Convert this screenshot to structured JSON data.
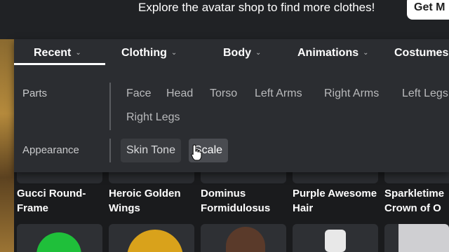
{
  "banner": {
    "text": "Explore the avatar shop to find more clothes!",
    "button_label": "Get M"
  },
  "tabs": [
    {
      "label": "Recent",
      "active": true
    },
    {
      "label": "Clothing"
    },
    {
      "label": "Body"
    },
    {
      "label": "Animations"
    },
    {
      "label": "Costumes"
    }
  ],
  "menu": {
    "parts_label": "Parts",
    "parts_options": [
      "Face",
      "Head",
      "Torso",
      "Left Arms",
      "Right Arms",
      "Left Legs",
      "Right Legs"
    ],
    "appearance_label": "Appearance",
    "appearance_options": [
      "Skin Tone",
      "Scale"
    ]
  },
  "items": [
    {
      "name": "Gucci Round-Frame"
    },
    {
      "name": "Heroic Golden Wings"
    },
    {
      "name": "Dominus Formidulosus"
    },
    {
      "name": "Purple Awesome Hair"
    },
    {
      "name": "Sparkletime Crown of O"
    }
  ],
  "colors": {
    "panel": "#2b2d31",
    "background": "#1a1b1d",
    "accent": "#ffffff"
  }
}
